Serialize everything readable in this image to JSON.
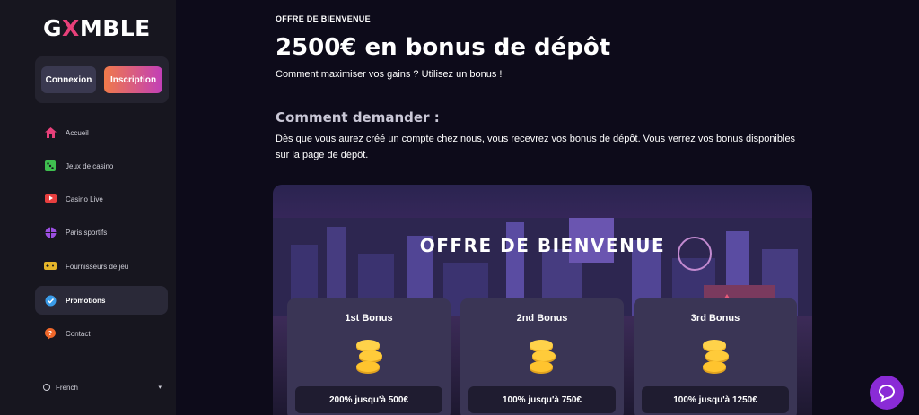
{
  "brand": {
    "logo_pre": "G",
    "logo_x": "X",
    "logo_post": "MBLE"
  },
  "auth": {
    "login_label": "Connexion",
    "signup_label": "Inscription"
  },
  "sidebar": {
    "items": [
      {
        "label": "Accueil",
        "icon": "home-icon"
      },
      {
        "label": "Jeux de casino",
        "icon": "dice-icon"
      },
      {
        "label": "Casino Live",
        "icon": "live-icon"
      },
      {
        "label": "Paris sportifs",
        "icon": "ball-icon"
      },
      {
        "label": "Fournisseurs de jeu",
        "icon": "gamepad-icon"
      },
      {
        "label": "Promotions",
        "icon": "badge-check-icon"
      },
      {
        "label": "Contact",
        "icon": "help-icon"
      }
    ],
    "active": "Promotions",
    "language": "French"
  },
  "main": {
    "eyebrow": "OFFRE DE BIENVENUE",
    "title": "2500€ en bonus de dépôt",
    "subtitle": "Comment maximiser vos gains ? Utilisez un bonus !",
    "how_title": "Comment demander :",
    "how_text": "Dès que vous aurez créé un compte chez nous, vous recevrez vos bonus de dépôt. Vous verrez vos bonus disponibles sur la page de dépôt.",
    "banner": {
      "title": "OFFRE DE BIENVENUE",
      "cards": [
        {
          "title": "1st Bonus",
          "offer": "200% jusqu'à 500€"
        },
        {
          "title": "2nd Bonus",
          "offer": "100% jusqu'à 750€"
        },
        {
          "title": "3rd Bonus",
          "offer": "100% jusqu'à 1250€"
        }
      ]
    }
  },
  "colors": {
    "accent_pink": "#e8407a",
    "signup_gradient_start": "#f07a4a",
    "signup_gradient_end": "#c23fb8",
    "chat_purple": "#8a2bd6"
  },
  "chat": {
    "icon": "chat-icon"
  }
}
